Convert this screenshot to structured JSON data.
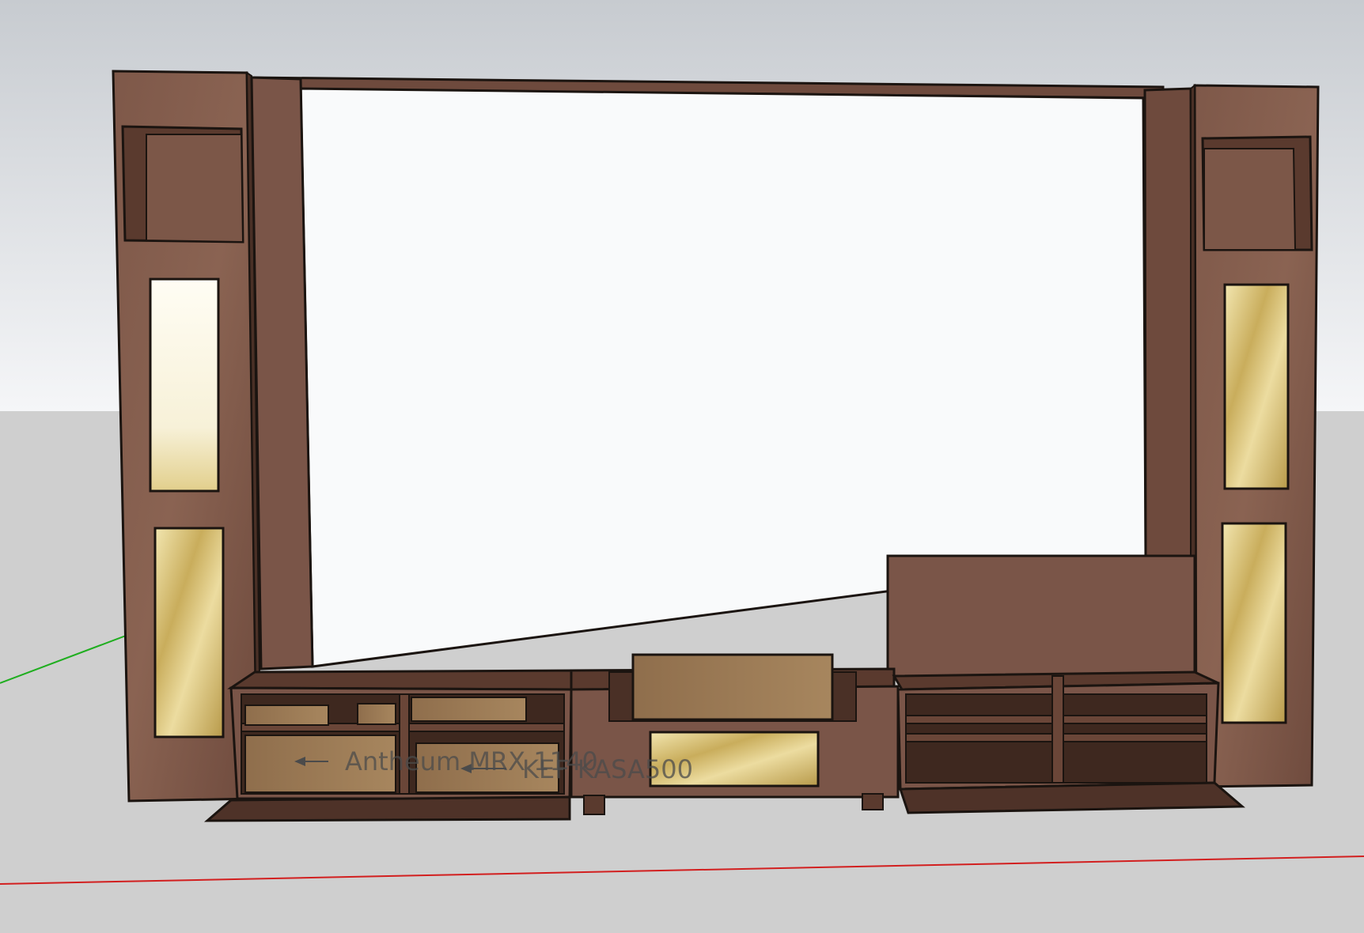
{
  "app": "SketchUp 3D model viewport",
  "colors": {
    "sky_top": "#c9ccd1",
    "sky_bottom": "#f4f5f7",
    "ground": "#cfcfcf",
    "wood": "#7a5548",
    "wood_dark": "#4a3026",
    "wood_light": "#8e6656",
    "shelf_wood": "#9b7a55",
    "gold": "#d9c47a",
    "edge": "#1b1410",
    "axis_red": "#d21f1f",
    "axis_green": "#1fae1f"
  },
  "model": {
    "component_tags": [
      {
        "name": "antheum-label",
        "text": "Antheum MRX 1140"
      },
      {
        "name": "kef-label",
        "text": "KEF KASA500"
      }
    ]
  },
  "icons": [
    "axis-red-line",
    "axis-green-line",
    "tag-leader-arrow"
  ]
}
